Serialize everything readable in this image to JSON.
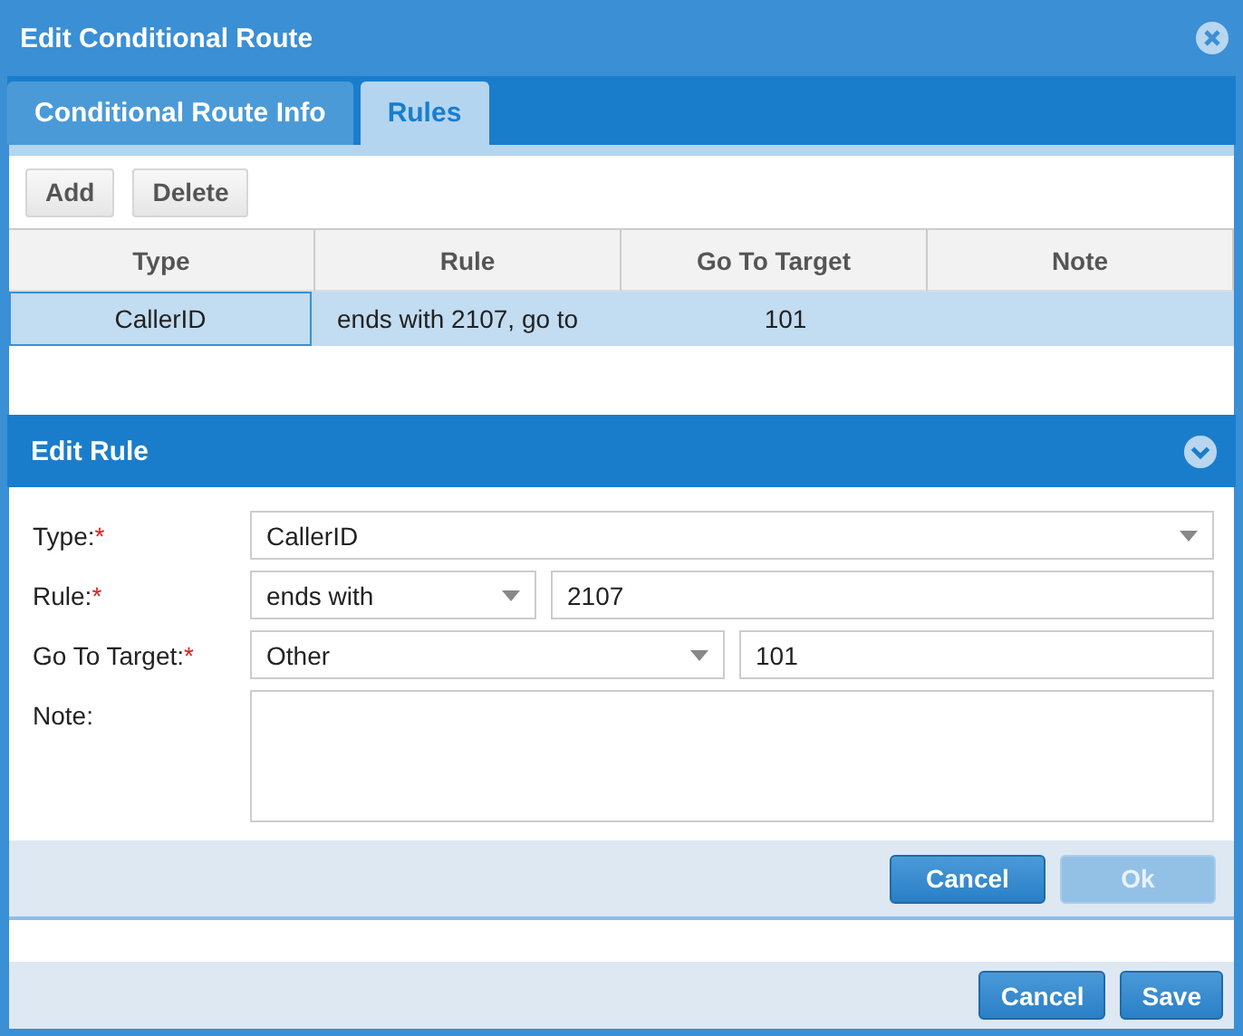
{
  "window": {
    "title": "Edit Conditional Route"
  },
  "tabs": [
    {
      "label": "Conditional Route Info",
      "selected": false
    },
    {
      "label": "Rules",
      "selected": true
    }
  ],
  "toolbar": {
    "buttons": [
      "Add",
      "Delete"
    ]
  },
  "table": {
    "columns": [
      "Type",
      "Rule",
      "Go To Target",
      "Note"
    ],
    "rows": [
      {
        "selected": true,
        "cells": [
          "CallerID",
          "ends with 2107, go to",
          "101",
          ""
        ]
      }
    ]
  },
  "edit_rule": {
    "title": "Edit Rule",
    "fields": [
      {
        "label": "Type:",
        "required_mark": "*",
        "controls": [
          {
            "kind": "select",
            "value": "CallerID"
          }
        ]
      },
      {
        "label": "Rule:",
        "required_mark": "*",
        "controls": [
          {
            "kind": "select",
            "value": "ends with"
          },
          {
            "kind": "text",
            "value": "2107"
          }
        ]
      },
      {
        "label": "Go To Target:",
        "required_mark": "*",
        "controls": [
          {
            "kind": "select",
            "value": "Other"
          },
          {
            "kind": "text",
            "value": "101"
          }
        ]
      },
      {
        "label": "Note:",
        "controls": [
          {
            "kind": "textarea"
          }
        ]
      }
    ],
    "buttons": [
      {
        "label": "Cancel",
        "disabled": false
      },
      {
        "label": "Ok",
        "disabled": true
      }
    ]
  },
  "footer": {
    "buttons": [
      {
        "label": "Cancel",
        "disabled": false
      },
      {
        "label": "Save",
        "disabled": false
      }
    ]
  }
}
